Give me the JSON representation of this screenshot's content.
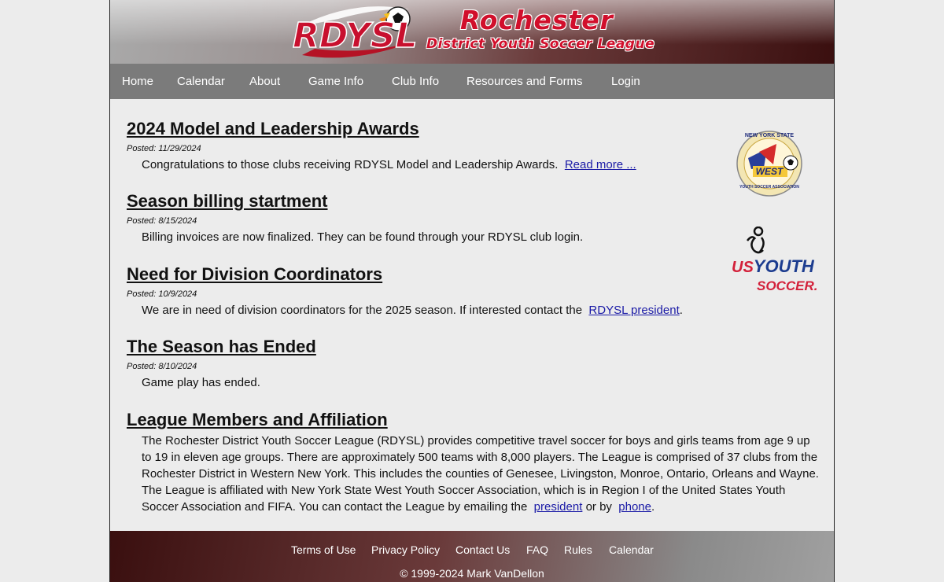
{
  "banner": {
    "logo_text": "RDYSL",
    "title": "Rochester",
    "subtitle": "District Youth Soccer League",
    "colors": {
      "red": "#d10f2b",
      "dark": "#3a0f0f"
    }
  },
  "nav": {
    "items": [
      {
        "label": "Home"
      },
      {
        "label": "Calendar"
      },
      {
        "label": "About"
      },
      {
        "label": "Game Info"
      },
      {
        "label": "Club Info"
      },
      {
        "label": "Resources and Forms"
      },
      {
        "label": "Login"
      }
    ]
  },
  "posts": [
    {
      "title": "2024 Model and Leadership Awards",
      "date": "Posted: 11/29/2024",
      "body": "Congratulations to those clubs receiving RDYSL Model and Leadership Awards.",
      "link": "Read more ..."
    },
    {
      "title": "Season billing startment",
      "date": "Posted: 8/15/2024",
      "body": "Billing invoices are now finalized. They can be found through your RDYSL club login."
    },
    {
      "title": "Need for Division Coordinators",
      "date": "Posted: 10/9/2024",
      "body": "We are in need of division coordinators for the 2025 season. If interested contact the",
      "link": "RDYSL president",
      "suffix": "."
    },
    {
      "title": "The Season has Ended",
      "date": "Posted: 8/10/2024",
      "body": "Game play has ended."
    }
  ],
  "affiliation": {
    "title": "League Members and Affiliation",
    "body": "The Rochester District Youth Soccer League (RDYSL) provides competitive travel soccer for boys and girls teams from age 9 up to 19 in eleven age groups. There are approximately 500 teams with 8,000 players. The League is comprised of 37 clubs from the Rochester District in Western New York. This includes the counties of Genesee, Livingston, Monroe, Ontario, Orleans and Wayne. The League is affiliated with New York State West Youth Soccer Association, which is in Region I of the United States Youth Soccer Association and FIFA. You can contact the League by emailing the",
    "link_president": "president",
    "or_by": "or by",
    "link_phone": "phone",
    "suffix": "."
  },
  "side_logos": {
    "nysw": {
      "top": "NEW YORK STATE",
      "middle": "WEST",
      "bottom": "YOUTH SOCCER ASSOCIATION"
    },
    "usys": {
      "line1": "US",
      "line2": "YOUTH",
      "line3": "SOCCER."
    }
  },
  "footer": {
    "links": [
      {
        "label": "Terms of Use"
      },
      {
        "label": "Privacy Policy"
      },
      {
        "label": "Contact Us"
      },
      {
        "label": "FAQ"
      },
      {
        "label": "Rules"
      },
      {
        "label": "Calendar"
      }
    ],
    "copyright": "© 1999-2024 Mark VanDellon"
  }
}
